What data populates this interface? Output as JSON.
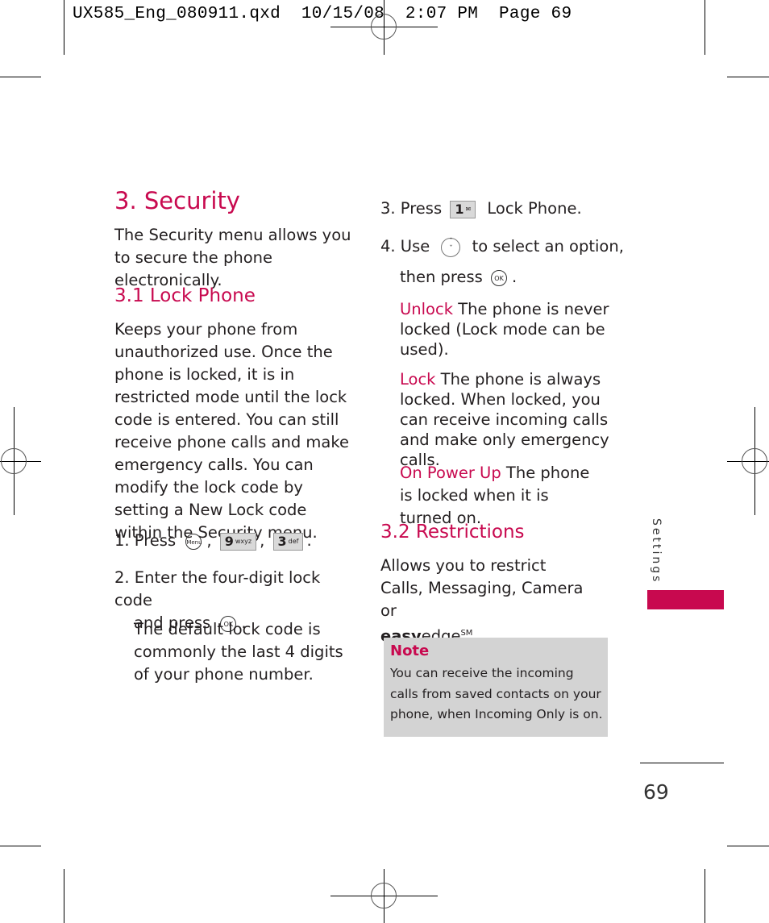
{
  "slug": {
    "filename": "UX585_Eng_080911.qxd",
    "date": "10/15/08",
    "time": "2:07 PM",
    "page_label": "Page 69"
  },
  "heading": "3. Security",
  "intro": "The Security menu allows you to secure the phone electronically.",
  "section_3_1": {
    "title": "3.1 Lock Phone",
    "body": "Keeps your phone from unauthorized use. Once the phone is locked, it is in restricted mode until the lock code is entered. You can still receive phone calls and make emergency calls. You can modify the lock code by setting a New Lock code within the Security menu.",
    "steps": {
      "step1": {
        "prefix": "1. Press",
        "key_menu": "Menu",
        "key_9_digit": "9",
        "key_9_letters": "wxyz",
        "key_3_digit": "3",
        "key_3_letters": "def",
        "sep": ",",
        "end": "."
      },
      "step2": {
        "text": "2. Enter the four-digit lock code",
        "text2": "and press",
        "key_ok": "OK",
        "end": ".",
        "note": "The default lock code is commonly the last 4 digits of your phone number."
      },
      "step3": {
        "prefix": "3. Press",
        "key_1_digit": "1",
        "key_1_icon": "voicemail-icon",
        "target": "Lock Phone",
        "end": "."
      },
      "step4": {
        "prefix": "4. Use",
        "key_nav": "navigation-key",
        "suffix": "to select an option,",
        "text2": "then press",
        "key_ok": "OK",
        "end": "."
      }
    },
    "options": [
      {
        "label": "Unlock",
        "desc": "The phone is never locked (Lock mode can be used)."
      },
      {
        "label": "Lock",
        "desc": "The phone is always locked. When locked, you can receive incoming calls and make only emergency calls."
      },
      {
        "label": "On Power Up",
        "desc": "The phone is locked when it is turned on."
      }
    ]
  },
  "section_3_2": {
    "title": "3.2 Restrictions",
    "body": "Allows you to restrict Calls, Messaging, Camera or",
    "brand_bold": "easy",
    "brand_normal": "edge",
    "brand_sup": "SM",
    "end": "."
  },
  "note": {
    "title": "Note",
    "text": "You can receive the incoming calls from saved contacts on your phone, when Incoming Only is on."
  },
  "side_tab": {
    "label": "Settings",
    "accent_color": "#c8094f"
  },
  "page_number": "69",
  "colors": {
    "accent": "#c8094f",
    "note_bg": "#d3d3d3"
  }
}
